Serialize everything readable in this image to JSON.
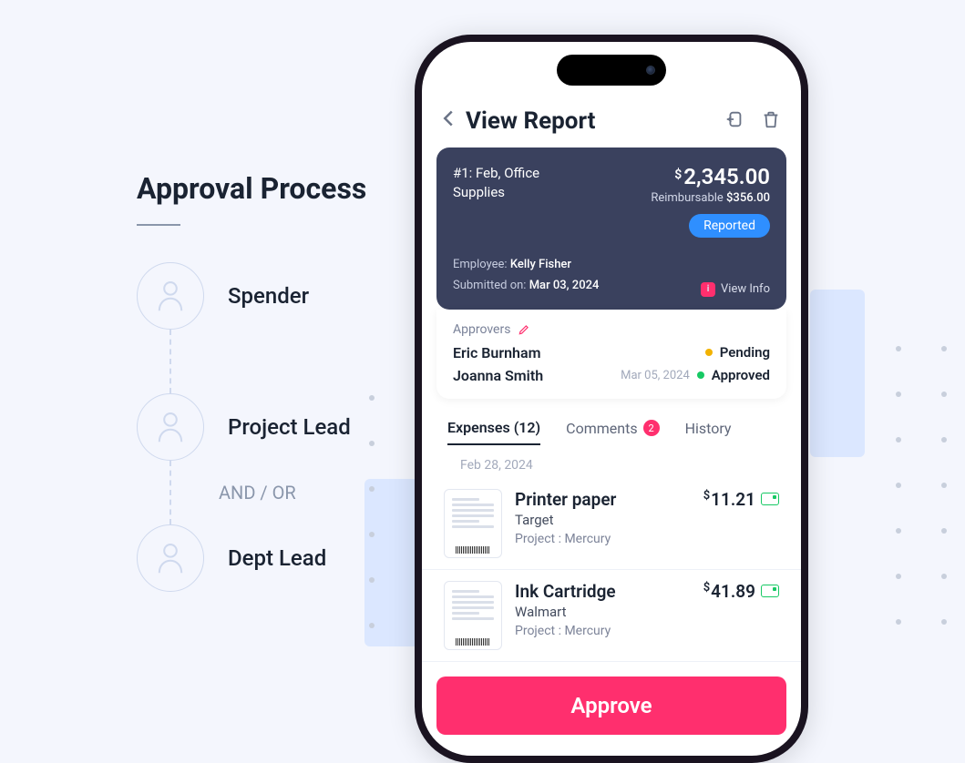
{
  "approval_panel": {
    "title": "Approval Process",
    "steps": [
      "Spender",
      "Project Lead",
      "Dept Lead"
    ],
    "connector_label": "AND / OR"
  },
  "header": {
    "title": "View Report"
  },
  "report": {
    "title": "#1: Feb, Office Supplies",
    "amount_currency": "$",
    "amount": "2,345.00",
    "reimbursable_label": "Reimbursable",
    "reimbursable_amount": "$356.00",
    "status": "Reported",
    "employee_label": "Employee:",
    "employee_name": "Kelly Fisher",
    "submitted_label": "Submitted on:",
    "submitted_date": "Mar 03, 2024",
    "view_info_label": "View Info"
  },
  "approvers": {
    "label": "Approvers",
    "rows": [
      {
        "name": "Eric Burnham",
        "date": "",
        "status": "Pending",
        "dot": "pending"
      },
      {
        "name": "Joanna Smith",
        "date": "Mar 05, 2024",
        "status": "Approved",
        "dot": "approved"
      }
    ]
  },
  "tabs": {
    "expenses_label": "Expenses (12)",
    "comments_label": "Comments",
    "comments_badge": "2",
    "history_label": "History"
  },
  "expenses": {
    "date_header": "Feb 28, 2024",
    "items": [
      {
        "title": "Printer paper",
        "vendor": "Target",
        "project": "Project : Mercury",
        "currency": "$",
        "amount": "11.21"
      },
      {
        "title": "Ink Cartridge",
        "vendor": "Walmart",
        "project": "Project : Mercury",
        "currency": "$",
        "amount": "41.89"
      }
    ]
  },
  "approve_button": "Approve"
}
